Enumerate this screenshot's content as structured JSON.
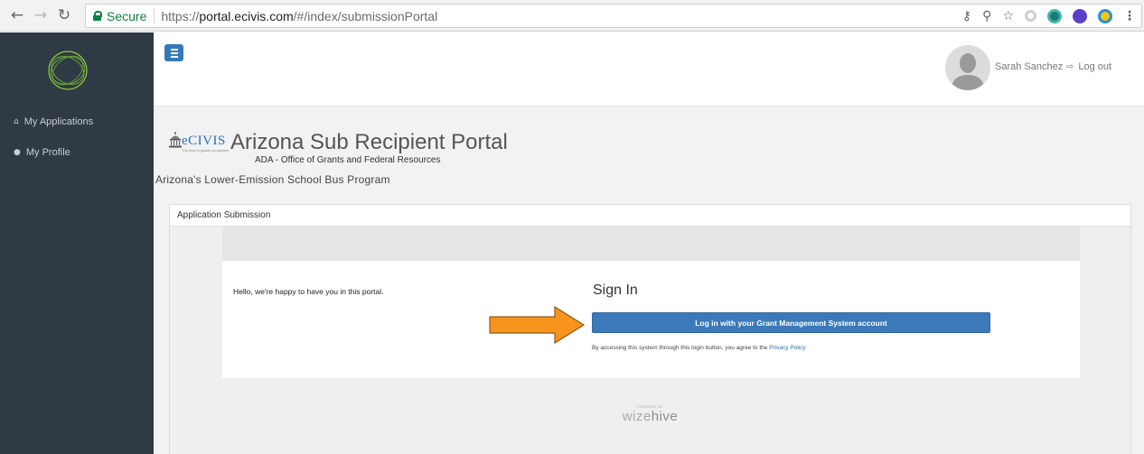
{
  "browser": {
    "secure_label": "Secure",
    "url_scheme": "https://",
    "url_host": "portal.ecivis.com",
    "url_path": "/#/index/submissionPortal"
  },
  "sidebar": {
    "items": [
      {
        "label": "My Applications",
        "icon": "home-icon"
      },
      {
        "label": "My Profile",
        "icon": "user-icon"
      }
    ]
  },
  "header": {
    "user_name": "Sarah Sanchez",
    "logout_label": "Log out"
  },
  "brand": {
    "logo_text": "eCIVIS",
    "logo_tagline": "The best in grants ecosystem",
    "portal_title": "Arizona Sub Recipient Portal",
    "portal_subtitle": "ADA - Office of Grants and Federal Resources",
    "program_name": "Arizona's Lower-Emission School Bus Program"
  },
  "panel": {
    "heading": "Application Submission",
    "hello_text": "Hello, we're happy to have you in this portal.",
    "signin_title": "Sign In",
    "login_button": "Log in with your Grant Management System account",
    "terms_prefix": "By accessing this system through this login button, you agree to the ",
    "privacy_link": "Privacy Policy",
    "powered_by": "POWERED BY",
    "powered_brand_a": "wize",
    "powered_brand_b": "hive"
  },
  "colors": {
    "sidebar_bg": "#2f3a44",
    "primary_button": "#3b79b9",
    "arrow": "#f7941d",
    "secure_green": "#0b8043"
  }
}
